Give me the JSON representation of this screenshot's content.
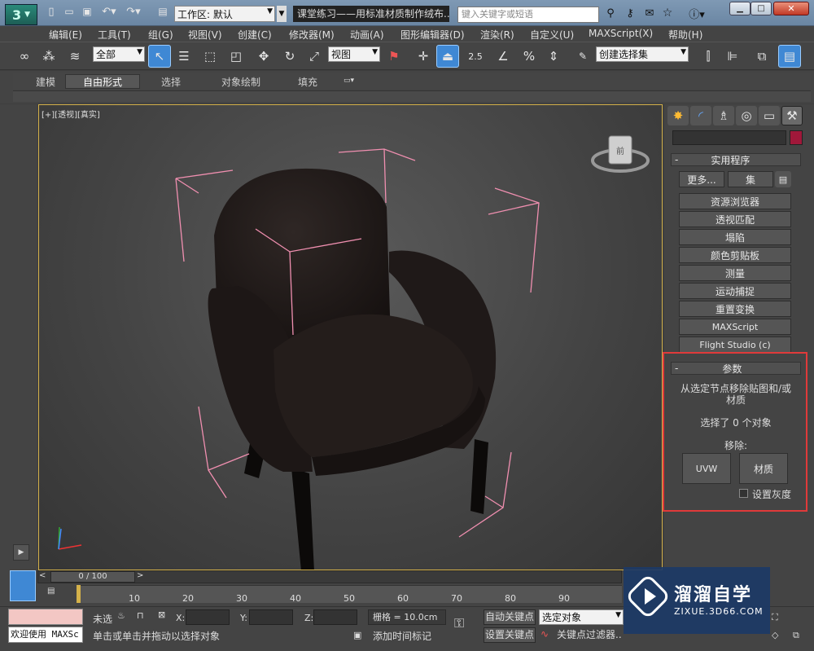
{
  "titlebar": {
    "workspace_label": "工作区: 默认",
    "doc_title": "课堂练习——用标准材质制作绒布...",
    "search_placeholder": "键入关键字或短语"
  },
  "menu": [
    "编辑(E)",
    "工具(T)",
    "组(G)",
    "视图(V)",
    "创建(C)",
    "修改器(M)",
    "动画(A)",
    "图形编辑器(D)",
    "渲染(R)",
    "自定义(U)",
    "MAXScript(X)",
    "帮助(H)"
  ],
  "toolbar": {
    "filter_select": "全部",
    "coord_select": "视图",
    "snap_label": "2.5",
    "named_sel_set": "创建选择集"
  },
  "ribbon": {
    "tabs": [
      "建模",
      "自由形式",
      "选择",
      "对象绘制",
      "填充"
    ],
    "active_tab": "自由形式"
  },
  "viewport": {
    "label": "[+][透视][真实]",
    "viewcube_text": "前"
  },
  "command_panel": {
    "utilities_title": "实用程序",
    "more_button": "更多...",
    "sets_button": "集",
    "utilities": [
      "资源浏览器",
      "透视匹配",
      "塌陷",
      "颜色剪贴板",
      "测量",
      "运动捕捉",
      "重置变换",
      "MAXScript",
      "Flight Studio (c)"
    ],
    "params_title": "参数",
    "params_desc": "从选定节点移除贴图和/或材质",
    "selected_info": "选择了 0 个对象",
    "remove_label": "移除:",
    "uvw_button": "UVW",
    "material_button": "材质",
    "gray_checkbox": "设置灰度"
  },
  "timeline": {
    "frame_counter": "0 / 100",
    "ticks": [
      "10",
      "20",
      "30",
      "40",
      "50",
      "60",
      "70",
      "80",
      "90"
    ]
  },
  "status": {
    "maxscript_text": "欢迎使用 MAXSc",
    "not_selected": "未选",
    "x_label": "X:",
    "y_label": "Y:",
    "z_label": "Z:",
    "grid_text": "栅格 = 10.0cm",
    "auto_key": "自动关键点",
    "selected_object": "选定对象",
    "set_key": "设置关键点",
    "key_filter": "关键点过滤器...",
    "hint_text": "单击或单击并拖动以选择对象",
    "add_time_tag": "添加时间标记"
  },
  "watermark": {
    "brand": "溜溜自学",
    "url": "ZIXUE.3D66.COM"
  },
  "colors": {
    "viewport_border": "#d4b14a",
    "highlight_red": "#e03a3a",
    "selection_blue": "#3f88d4",
    "watermark_bg": "#1c3a66"
  }
}
